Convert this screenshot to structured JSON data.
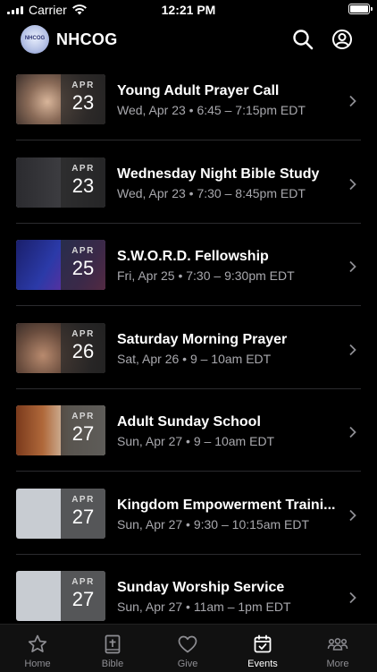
{
  "status_bar": {
    "carrier": "Carrier",
    "time": "12:21 PM"
  },
  "header": {
    "logo_text": "NHCOG",
    "app_name": "NHCOG"
  },
  "colors": {
    "background": "#000000",
    "text_secondary": "#a8a8ad",
    "divider": "#2b2b2e"
  },
  "events": [
    {
      "title": "Young Adult Prayer Call",
      "subtitle": "Wed, Apr 23 • 6:45 – 7:15pm EDT",
      "month": "APR",
      "day": "23"
    },
    {
      "title": "Wednesday Night Bible Study",
      "subtitle": "Wed, Apr 23 • 7:30 – 8:45pm EDT",
      "month": "APR",
      "day": "23"
    },
    {
      "title": "S.W.O.R.D. Fellowship",
      "subtitle": "Fri, Apr 25 • 7:30 – 9:30pm EDT",
      "month": "APR",
      "day": "25"
    },
    {
      "title": "Saturday Morning Prayer",
      "subtitle": "Sat, Apr 26 • 9 – 10am EDT",
      "month": "APR",
      "day": "26"
    },
    {
      "title": "Adult Sunday School",
      "subtitle": "Sun, Apr 27 • 9 – 10am EDT",
      "month": "APR",
      "day": "27"
    },
    {
      "title": "Kingdom Empowerment Traini...",
      "subtitle": "Sun, Apr 27 • 9:30 – 10:15am EDT",
      "month": "APR",
      "day": "27"
    },
    {
      "title": "Sunday Worship Service",
      "subtitle": "Sun, Apr 27 • 11am – 1pm EDT",
      "month": "APR",
      "day": "27"
    }
  ],
  "tabs": [
    {
      "label": "Home",
      "icon": "star-icon",
      "active": false
    },
    {
      "label": "Bible",
      "icon": "bible-icon",
      "active": false
    },
    {
      "label": "Give",
      "icon": "heart-icon",
      "active": false
    },
    {
      "label": "Events",
      "icon": "calendar-icon",
      "active": true
    },
    {
      "label": "More",
      "icon": "people-icon",
      "active": false
    }
  ]
}
